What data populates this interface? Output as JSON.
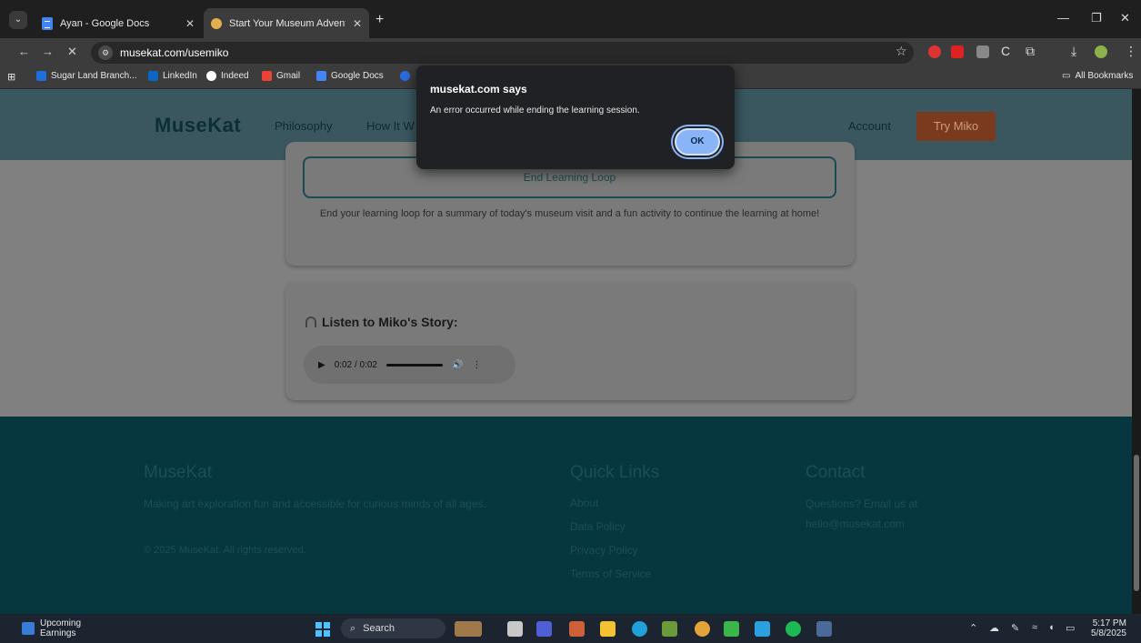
{
  "browser": {
    "tabs": [
      {
        "title": "Ayan - Google Docs",
        "active": false
      },
      {
        "title": "Start Your Museum Adventure",
        "active": true
      }
    ],
    "url": "musekat.com/usemiko",
    "bookmarks": [
      "Sugar Land Branch...",
      "LinkedIn",
      "Indeed",
      "Gmail",
      "Google Docs"
    ],
    "all_bookmarks": "All Bookmarks"
  },
  "header": {
    "logo": "MuseKat",
    "nav": [
      "Philosophy",
      "How It W"
    ],
    "account": "Account",
    "cta": "Try Miko"
  },
  "main": {
    "end_loop_button": "End Learning Loop",
    "end_loop_desc": "End your learning loop for a summary of today's museum visit and a fun activity to continue the learning at home!",
    "story_title": "Listen to Miko's Story:",
    "audio_time": "0:02 / 0:02",
    "audio_progress": 1.0
  },
  "footer": {
    "brand": "MuseKat",
    "tagline": "Making art exploration fun and accessible for curious minds of all ages.",
    "copyright": "© 2025 MuseKat. All rights reserved.",
    "quick_links_title": "Quick Links",
    "quick_links": [
      "About",
      "Data Policy",
      "Privacy Policy",
      "Terms of Service"
    ],
    "contact_title": "Contact",
    "contact_text": "Questions? Email us at",
    "contact_email": "hello@musekat.com"
  },
  "dialog": {
    "title": "musekat.com says",
    "message": "An error occurred while ending the learning session.",
    "ok": "OK"
  },
  "taskbar": {
    "widget_line1": "Upcoming",
    "widget_line2": "Earnings",
    "search": "Search",
    "time": "5:17 PM",
    "date": "5/8/2025"
  }
}
